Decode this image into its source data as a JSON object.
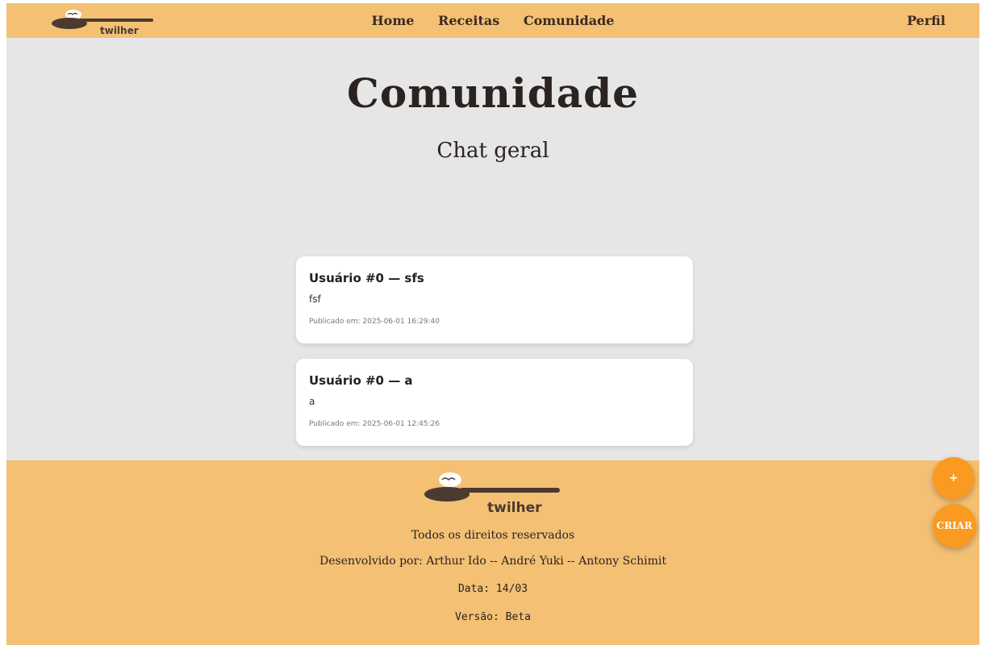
{
  "header": {
    "logo_text": "twilher",
    "nav": [
      {
        "label": "Home"
      },
      {
        "label": "Receitas"
      },
      {
        "label": "Comunidade"
      }
    ],
    "profile_label": "Perfil"
  },
  "page": {
    "title": "Comunidade",
    "subtitle": "Chat geral"
  },
  "posts": [
    {
      "title": "Usuário #0 — sfs",
      "body": "fsf",
      "published": "Publicado em: 2025-06-01 16:29:40"
    },
    {
      "title": "Usuário #0 — a",
      "body": "a",
      "published": "Publicado em: 2025-06-01 12:45:26"
    }
  ],
  "footer": {
    "logo_text": "twilher",
    "rights": "Todos os direitos reservados",
    "developers": "Desenvolvido por: Arthur Ido -- André Yuki -- Antony Schimit",
    "date": "Data: 14/03",
    "version": "Versão: Beta"
  },
  "fab": {
    "plus_label": "+",
    "create_label": "CRIAR"
  },
  "colors": {
    "bar": "#f4c074",
    "background": "#e6e6e6",
    "fab": "#fb9a21",
    "logo_brown": "#4a3a30"
  }
}
